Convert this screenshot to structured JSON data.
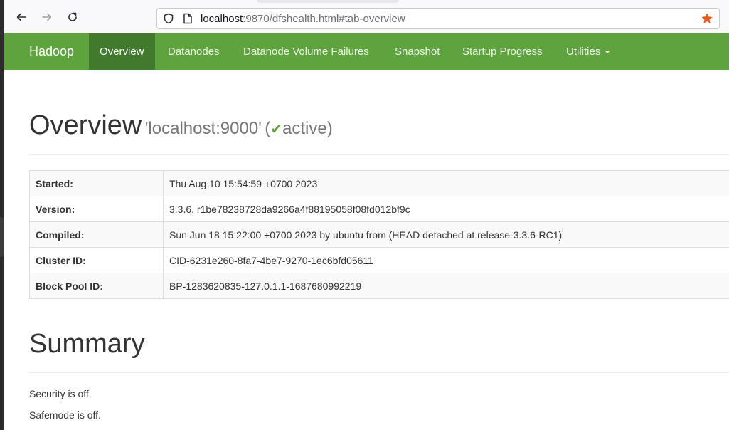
{
  "browser": {
    "url_host": "localhost",
    "url_rest": ":9870/dfshealth.html#tab-overview"
  },
  "navbar": {
    "brand": "Hadoop",
    "items": [
      {
        "label": "Overview",
        "active": true
      },
      {
        "label": "Datanodes"
      },
      {
        "label": "Datanode Volume Failures"
      },
      {
        "label": "Snapshot"
      },
      {
        "label": "Startup Progress"
      },
      {
        "label": "Utilities"
      }
    ]
  },
  "overview": {
    "title": "Overview",
    "host": "'localhost:9000'",
    "status_open": "(",
    "status_check": "✔",
    "status": "active",
    "status_close": ")",
    "rows": [
      {
        "label": "Started:",
        "value": "Thu Aug 10 15:54:59 +0700 2023"
      },
      {
        "label": "Version:",
        "value": "3.3.6, r1be78238728da9266a4f88195058f08fd012bf9c"
      },
      {
        "label": "Compiled:",
        "value": "Sun Jun 18 15:22:00 +0700 2023 by ubuntu from (HEAD detached at release-3.3.6-RC1)"
      },
      {
        "label": "Cluster ID:",
        "value": "CID-6231e260-8fa7-4be7-9270-1ec6bfd05611"
      },
      {
        "label": "Block Pool ID:",
        "value": "BP-1283620835-127.0.1.1-1687680992219"
      }
    ]
  },
  "summary": {
    "title": "Summary",
    "security": "Security is off.",
    "safemode": "Safemode is off."
  },
  "colors": {
    "navbar": "#5fa33e",
    "navbar_active": "#417a2d",
    "check": "#5fa33e",
    "bookmark_star": "#e8591a"
  }
}
